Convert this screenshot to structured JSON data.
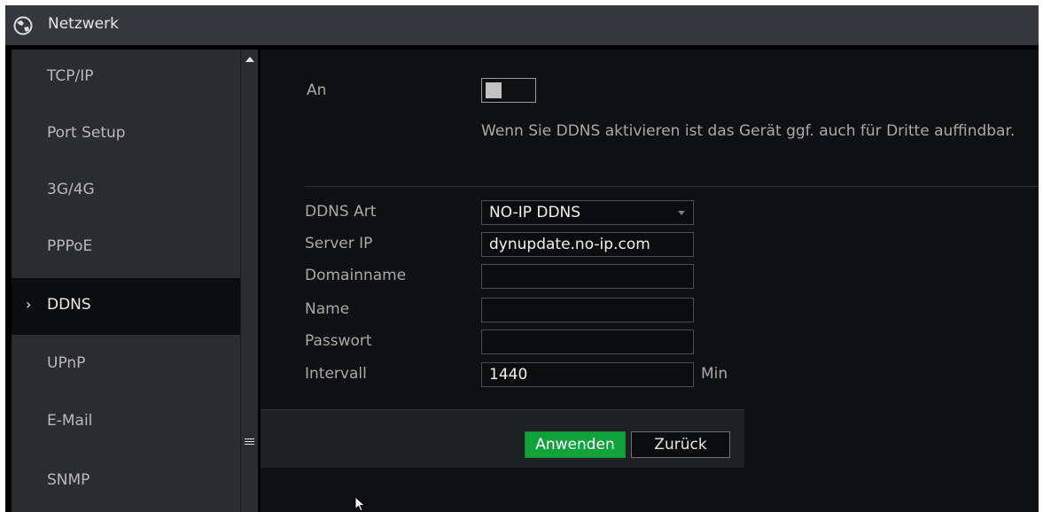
{
  "window": {
    "title": "Netzwerk",
    "logo_icon": "globe-icon"
  },
  "sidebar": {
    "items": [
      {
        "label": "TCP/IP",
        "active": false
      },
      {
        "label": "Port Setup",
        "active": false
      },
      {
        "label": "3G/4G",
        "active": false
      },
      {
        "label": "PPPoE",
        "active": false
      },
      {
        "label": "DDNS",
        "active": true,
        "marker": "›"
      },
      {
        "label": "UPnP",
        "active": false
      },
      {
        "label": "E-Mail",
        "active": false
      },
      {
        "label": "SNMP",
        "active": false
      }
    ]
  },
  "form": {
    "enable_label": "An",
    "enable_state": false,
    "hint": "Wenn Sie DDNS aktivieren ist das Gerät ggf. auch für Dritte auffindbar.",
    "ddns_type_label": "DDNS Art",
    "ddns_type_value": "NO-IP DDNS",
    "server_ip_label": "Server IP",
    "server_ip_value": "dynupdate.no-ip.com",
    "domain_label": "Domainname",
    "domain_value": "",
    "name_label": "Name",
    "name_value": "",
    "password_label": "Passwort",
    "password_value": "",
    "interval_label": "Intervall",
    "interval_value": "1440",
    "interval_unit": "Min"
  },
  "buttons": {
    "apply": "Anwenden",
    "back": "Zurück"
  },
  "colors": {
    "accent_green": "#10a33c",
    "panel": "#0f1012",
    "sidebar": "#2a2c30"
  }
}
